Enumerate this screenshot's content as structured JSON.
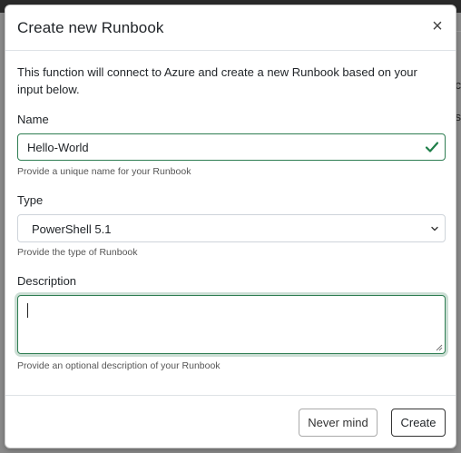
{
  "modal": {
    "title": "Create new Runbook",
    "close_label": "×",
    "intro": "This function will connect to Azure and create a new Runbook based on your input below."
  },
  "form": {
    "name": {
      "label": "Name",
      "value": "Hello-World",
      "help": "Provide a unique name for your Runbook",
      "valid": true
    },
    "type": {
      "label": "Type",
      "selected": "PowerShell 5.1",
      "help": "Provide the type of Runbook"
    },
    "description": {
      "label": "Description",
      "value": "",
      "help": "Provide an optional description of your Runbook"
    }
  },
  "footer": {
    "never_mind_label": "Never mind",
    "create_label": "Create"
  },
  "background": {
    "frag_top": "c",
    "frag_mid": "s"
  },
  "colors": {
    "valid_green": "#2e7d52",
    "check_green": "#1e7e48"
  },
  "icons": [
    "close-icon",
    "check-icon",
    "chevron-down-icon",
    "resize-handle-icon"
  ]
}
